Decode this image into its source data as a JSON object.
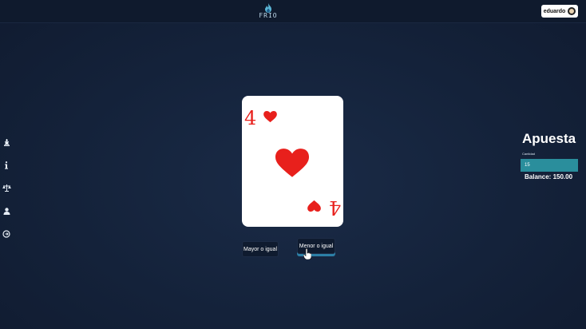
{
  "header": {
    "logo_text": "FRIO",
    "user_name": "eduardo"
  },
  "sidebar": {
    "items": [
      {
        "icon": "chess-king-icon"
      },
      {
        "icon": "info-icon"
      },
      {
        "icon": "scales-icon"
      },
      {
        "icon": "user-icon"
      },
      {
        "icon": "logout-icon"
      }
    ]
  },
  "card": {
    "rank": "4",
    "suit": "hearts",
    "color": "#e8201c"
  },
  "actions": {
    "higher_label": "Mayor o igual",
    "lower_label": "Menor o igual"
  },
  "bet": {
    "title": "Apuesta",
    "amount_label": "Cantidad",
    "amount_value": "15",
    "balance_text": "Balance: 150.00"
  },
  "colors": {
    "background": "#14223a",
    "topbar": "#0f1a2d",
    "input_accent": "#2a8e9c",
    "card_red": "#e8201c"
  }
}
